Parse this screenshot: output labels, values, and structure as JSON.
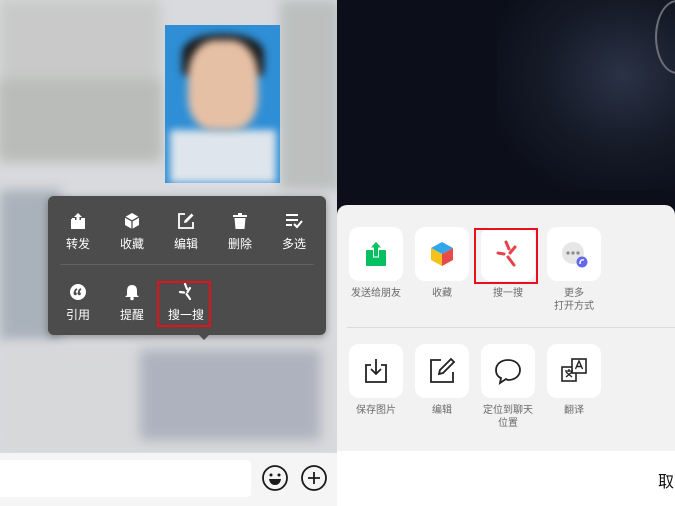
{
  "context_menu": {
    "row1": [
      {
        "label": "转发",
        "icon": "share-out-icon"
      },
      {
        "label": "收藏",
        "icon": "cube-icon"
      },
      {
        "label": "编辑",
        "icon": "edit-icon"
      },
      {
        "label": "删除",
        "icon": "trash-icon"
      },
      {
        "label": "多选",
        "icon": "multi-select-icon"
      }
    ],
    "row2": [
      {
        "label": "引用",
        "icon": "quote-icon"
      },
      {
        "label": "提醒",
        "icon": "bell-icon"
      },
      {
        "label": "搜一搜",
        "icon": "sou-yi-sou-icon"
      }
    ]
  },
  "share_sheet": {
    "row1": [
      {
        "label": "发送给朋友",
        "icon": "send-friend-icon"
      },
      {
        "label": "收藏",
        "icon": "favorite-cube-icon"
      },
      {
        "label": "搜一搜",
        "icon": "sou-yi-sou-icon"
      },
      {
        "label_line1": "更多",
        "label_line2": "打开方式",
        "icon": "more-open-icon"
      }
    ],
    "row2": [
      {
        "label": "保存图片",
        "icon": "save-image-icon"
      },
      {
        "label": "编辑",
        "icon": "edit-icon"
      },
      {
        "label_line1": "定位到聊天",
        "label_line2": "位置",
        "icon": "chat-locate-icon"
      },
      {
        "label": "翻译",
        "icon": "translate-icon"
      }
    ],
    "cancel_label": "取"
  },
  "colors": {
    "highlight_box": "#e8111b",
    "menu_bg": "#4c4c4c",
    "wechat_green": "#07c160",
    "sou_red": "#e8414b"
  }
}
